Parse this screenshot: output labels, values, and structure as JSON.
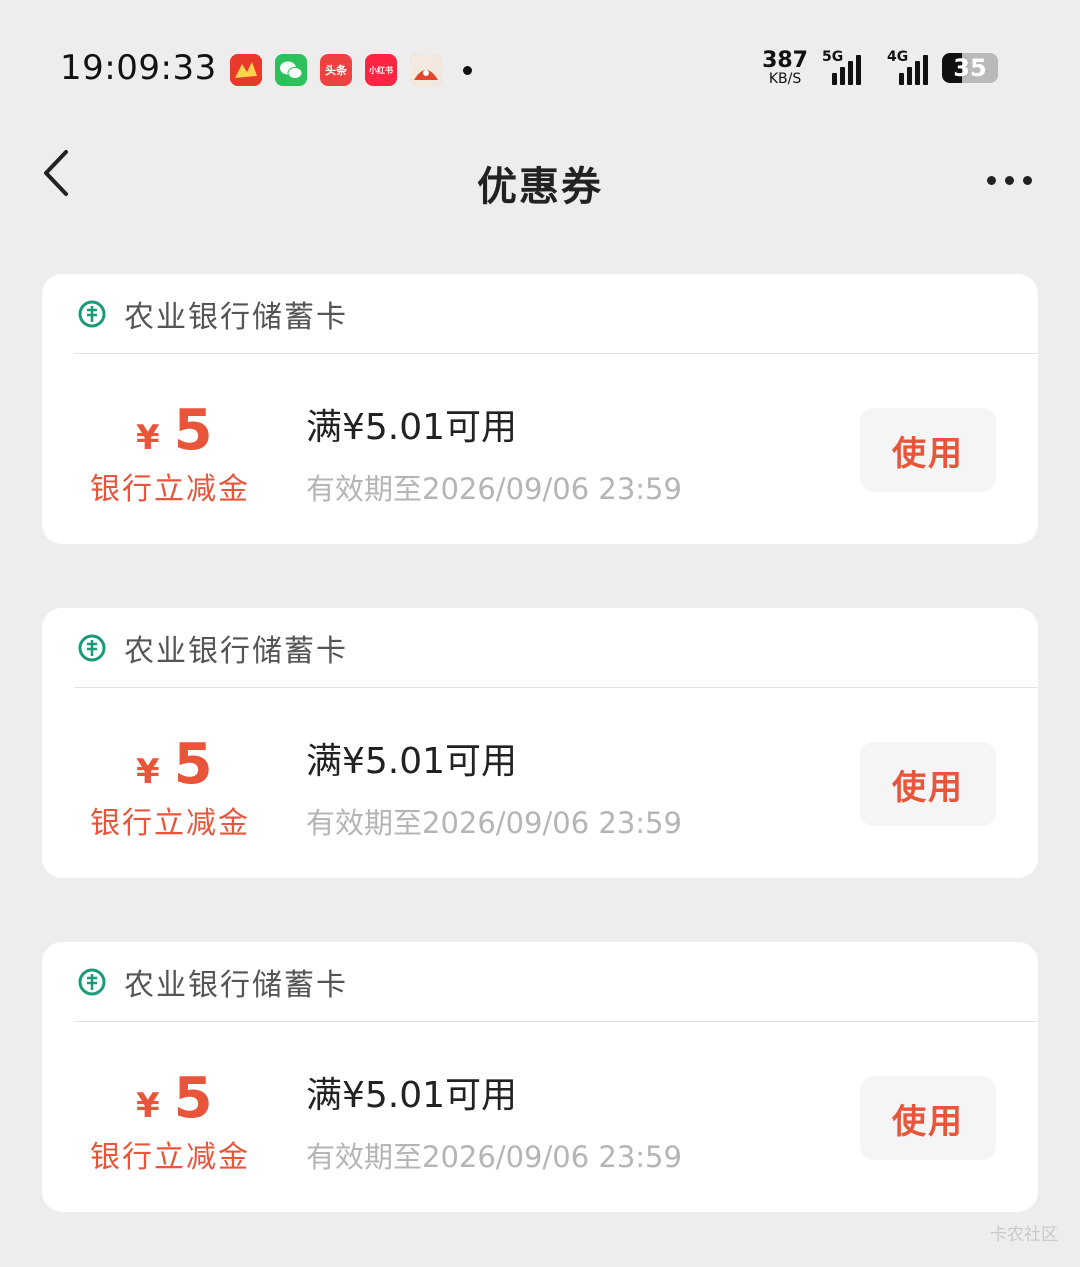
{
  "status_bar": {
    "time": "19:09:33",
    "notification_icons": [
      {
        "name": "game-app-icon",
        "color": "#e8392b",
        "label": ""
      },
      {
        "name": "wechat-icon",
        "color": "#2dc15b",
        "label": ""
      },
      {
        "name": "toutiao-icon",
        "color": "#f04142",
        "label": "头条"
      },
      {
        "name": "xiaohongshu-icon",
        "color": "#ff2442",
        "label": "小红书"
      },
      {
        "name": "shop-app-icon",
        "color": "#f06a2a",
        "label": ""
      }
    ],
    "net_speed_value": "387",
    "net_speed_unit": "KB/S",
    "signal_5g": "5G",
    "signal_4g": "4G",
    "battery": "35"
  },
  "nav": {
    "title": "优惠券"
  },
  "coupons": [
    {
      "bank": "农业银行储蓄卡",
      "currency": "¥",
      "amount": "5",
      "amount_label": "银行立减金",
      "condition": "满¥5.01可用",
      "validity": "有效期至2026/09/06 23:59",
      "button": "使用"
    },
    {
      "bank": "农业银行储蓄卡",
      "currency": "¥",
      "amount": "5",
      "amount_label": "银行立减金",
      "condition": "满¥5.01可用",
      "validity": "有效期至2026/09/06 23:59",
      "button": "使用"
    },
    {
      "bank": "农业银行储蓄卡",
      "currency": "¥",
      "amount": "5",
      "amount_label": "银行立减金",
      "condition": "满¥5.01可用",
      "validity": "有效期至2026/09/06 23:59",
      "button": "使用"
    }
  ],
  "colors": {
    "accent": "#e8553a",
    "bank_green": "#1a9a78"
  },
  "watermark": "卡农社区"
}
